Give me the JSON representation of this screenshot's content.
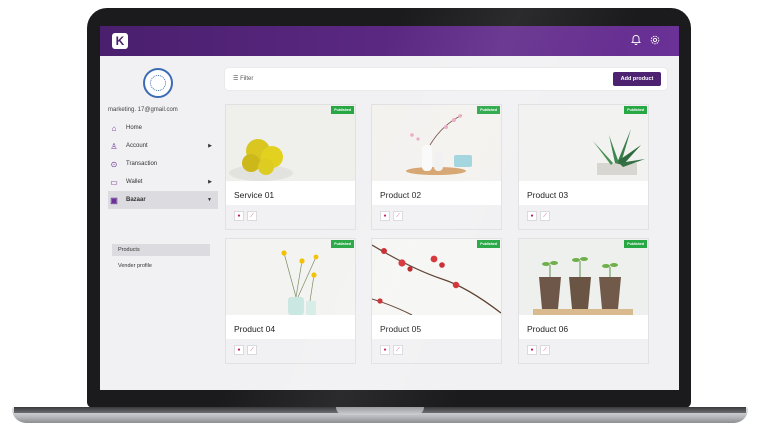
{
  "header": {
    "logo_text": "K",
    "bell_icon": "bell-icon",
    "settings_icon": "gear-icon",
    "accent_color": "#5e2a86"
  },
  "sidebar": {
    "email": "marketing.          17@gmail.com",
    "items": [
      {
        "label": "Home",
        "icon": "home-icon",
        "glyph": "⌂",
        "has_caret": false
      },
      {
        "label": "Account",
        "icon": "user-icon",
        "glyph": "♙",
        "has_caret": true
      },
      {
        "label": "Transaction",
        "icon": "transaction-icon",
        "glyph": "⊙",
        "has_caret": false
      },
      {
        "label": "Wallet",
        "icon": "wallet-icon",
        "glyph": "▭",
        "has_caret": true
      },
      {
        "label": "Bazaar",
        "icon": "bazaar-icon",
        "glyph": "▣",
        "has_caret": true,
        "active": true
      }
    ],
    "submenu": [
      {
        "label": "Products",
        "active": true
      },
      {
        "label": "Vender profile",
        "active": false
      }
    ]
  },
  "toolbar": {
    "filter_label": "Filter",
    "add_button": "Add product"
  },
  "products": [
    {
      "title": "Service 01",
      "badge": "Published"
    },
    {
      "title": "Product 02",
      "badge": "Published"
    },
    {
      "title": "Product 03",
      "badge": "Published"
    },
    {
      "title": "Product 04",
      "badge": "Published"
    },
    {
      "title": "Product 05",
      "badge": "Published"
    },
    {
      "title": "Product 06",
      "badge": "Published"
    }
  ],
  "card_actions": {
    "view_icon": "eye-icon",
    "stats_icon": "chart-icon"
  }
}
